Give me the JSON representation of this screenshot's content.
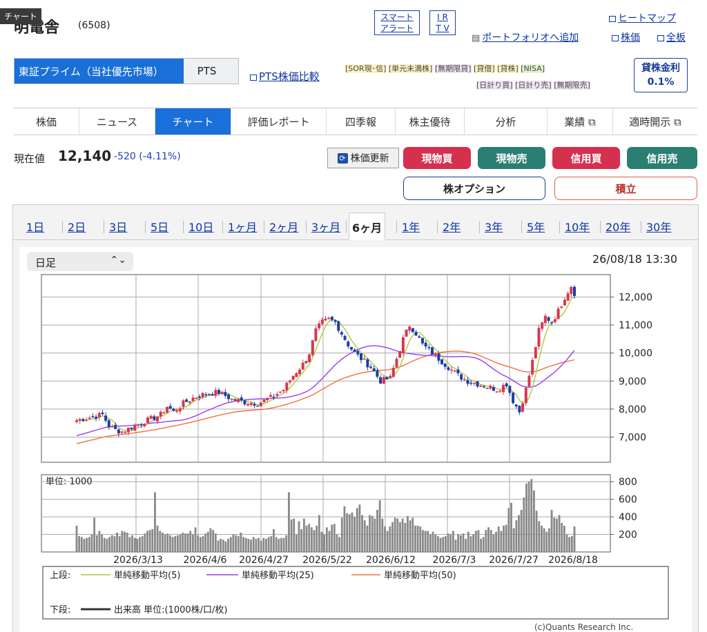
{
  "header": {
    "tooltip": "チャート",
    "company_name": "明電舎",
    "code": "(6508)",
    "smart_alert": [
      "スマート",
      "アラート"
    ],
    "ir_tv": [
      "I R",
      "T V"
    ],
    "heatmap": "ヒートマップ",
    "add_portfolio": "ポートフォリオへ追加",
    "stock_price": "株価",
    "full_board": "全板"
  },
  "market": {
    "primary": "東証プライム（当社優先市場）",
    "pts": "PTS",
    "pts_compare": "PTS株価比較"
  },
  "tags": {
    "row1": [
      "[SOR現･信]",
      "[単元未満株]",
      "[無期限貸]",
      "[貸借]",
      "[貸株]",
      "[NISA]"
    ],
    "row2": [
      "[日計り買]",
      "[日計り売]",
      "[無期限売]"
    ]
  },
  "lending": {
    "label": "貸株金利",
    "rate": "0.1%"
  },
  "nav": [
    "株価",
    "ニュース",
    "チャート",
    "評価レポート",
    "四季報",
    "株主優待",
    "分析",
    "業績 ⧉",
    "適時開示 ⧉"
  ],
  "nav_active": 2,
  "price": {
    "label": "現在値",
    "value": "12,140",
    "change": "-520 (-4.11%)",
    "refresh": "株価更新"
  },
  "trade_buttons": {
    "cash_buy": "現物買",
    "cash_sell": "現物売",
    "margin_buy": "信用買",
    "margin_sell": "信用売",
    "options": "株オプション",
    "accumulate": "積立"
  },
  "period_tabs": [
    "1日",
    "2日",
    "3日",
    "5日",
    "10日",
    "1ヶ月",
    "2ヶ月",
    "3ヶ月",
    "6ヶ月",
    "1年",
    "2年",
    "3年",
    "5年",
    "10年",
    "20年",
    "30年"
  ],
  "period_active": 8,
  "chart_controls": {
    "interval": "日足",
    "timestamp": "26/08/18 13:30",
    "copyright": "(c)Quants Research Inc."
  },
  "chart_data": {
    "type": "candlestick",
    "price_axis": {
      "ticks": [
        7000,
        8000,
        9000,
        10000,
        11000,
        12000
      ],
      "labels": [
        "7,000",
        "8,000",
        "9,000",
        "10,000",
        "11,000",
        "12,000"
      ],
      "ylim": [
        6100,
        12800
      ]
    },
    "volume_axis": {
      "unit_label": "単位: 1000",
      "ticks": [
        200,
        400,
        600,
        800
      ],
      "labels": [
        "200",
        "400",
        "600",
        "800"
      ],
      "ylim": [
        0,
        880
      ]
    },
    "x_labels": [
      "2026/3/13",
      "2026/4/6",
      "2026/4/27",
      "2026/5/22",
      "2026/6/12",
      "2026/7/3",
      "2026/7/27",
      "2026/8/18"
    ],
    "close_path": [
      [
        0,
        7600
      ],
      [
        4,
        7700
      ],
      [
        8,
        7800
      ],
      [
        10,
        7400
      ],
      [
        12,
        7250
      ],
      [
        14,
        7200
      ],
      [
        18,
        7400
      ],
      [
        20,
        7500
      ],
      [
        22,
        7600
      ],
      [
        26,
        7800
      ],
      [
        28,
        8100
      ],
      [
        30,
        7900
      ],
      [
        33,
        8200
      ],
      [
        36,
        8400
      ],
      [
        40,
        8550
      ],
      [
        44,
        8600
      ],
      [
        48,
        8350
      ],
      [
        52,
        8250
      ],
      [
        56,
        8200
      ],
      [
        60,
        8400
      ],
      [
        64,
        8700
      ],
      [
        67,
        9200
      ],
      [
        70,
        9600
      ],
      [
        72,
        10000
      ],
      [
        74,
        10800
      ],
      [
        76,
        11100
      ],
      [
        78,
        11200
      ],
      [
        80,
        11100
      ],
      [
        82,
        10700
      ],
      [
        84,
        10300
      ],
      [
        86,
        10000
      ],
      [
        88,
        9800
      ],
      [
        91,
        9500
      ],
      [
        94,
        9000
      ],
      [
        97,
        9100
      ],
      [
        99,
        9800
      ],
      [
        101,
        10500
      ],
      [
        103,
        11000
      ],
      [
        105,
        10700
      ],
      [
        107,
        10300
      ],
      [
        109,
        10100
      ],
      [
        111,
        9900
      ],
      [
        113,
        9700
      ],
      [
        115,
        9500
      ],
      [
        118,
        9200
      ],
      [
        121,
        9000
      ],
      [
        124,
        8900
      ],
      [
        127,
        8800
      ],
      [
        130,
        8700
      ],
      [
        133,
        8900
      ],
      [
        135,
        8300
      ],
      [
        137,
        7900
      ],
      [
        139,
        8700
      ],
      [
        141,
        9700
      ],
      [
        143,
        10800
      ],
      [
        145,
        11300
      ],
      [
        147,
        11100
      ],
      [
        149,
        11500
      ],
      [
        151,
        12000
      ],
      [
        153,
        12400
      ],
      [
        154,
        12140
      ]
    ],
    "volume_bars": [
      300,
      180,
      170,
      150,
      160,
      170,
      200,
      390,
      190,
      240,
      200,
      160,
      150,
      170,
      190,
      180,
      220,
      180,
      240,
      230,
      220,
      170,
      190,
      160,
      150,
      170,
      180,
      210,
      240,
      250,
      260,
      680,
      300,
      240,
      220,
      200,
      210,
      190,
      170,
      180,
      190,
      200,
      220,
      210,
      210,
      240,
      200,
      280,
      190,
      170,
      180,
      210,
      230,
      270,
      250,
      210,
      130,
      150,
      140,
      120,
      150,
      170,
      200,
      190,
      180,
      220,
      170,
      160,
      150,
      140,
      170,
      150,
      160,
      130,
      160,
      150,
      170,
      180,
      260,
      170,
      150,
      160,
      160,
      190,
      680,
      370,
      380,
      200,
      350,
      260,
      380,
      300,
      320,
      280,
      250,
      300,
      420,
      230,
      200,
      280,
      240,
      310,
      320,
      200,
      170,
      390,
      520,
      440,
      430,
      450,
      400,
      500,
      540,
      420,
      360,
      300,
      420,
      410,
      380,
      480,
      590,
      380,
      290,
      240,
      290,
      340,
      390,
      380,
      340,
      380,
      330,
      410,
      360,
      390,
      300,
      300,
      290,
      250,
      240,
      240,
      200,
      230,
      200,
      180,
      160,
      170,
      180,
      210,
      200,
      240,
      140,
      200,
      190,
      210,
      150,
      230,
      180,
      200,
      240,
      250,
      150,
      170,
      250,
      280,
      250,
      200,
      230,
      290,
      240,
      300,
      310,
      500,
      560,
      270,
      360,
      420,
      480,
      620,
      780,
      800,
      830,
      700,
      470,
      350,
      300,
      270,
      230,
      270,
      480,
      390,
      380,
      420,
      330,
      300,
      200,
      170,
      180,
      290
    ]
  },
  "legend": {
    "upper_label": "上段:",
    "lower_label": "下段:",
    "ma5": "単純移動平均(5)",
    "ma25": "単純移動平均(25)",
    "ma50": "単純移動平均(50)",
    "volume": "出来高 単位:(1000株/口/枚)",
    "colors": {
      "ma5": "#a8cc3c",
      "ma25": "#9a3cf0",
      "ma50": "#f0703c",
      "candle_up": "#d9364f",
      "candle_down": "#1f3ca8",
      "volume": "#888888"
    }
  }
}
